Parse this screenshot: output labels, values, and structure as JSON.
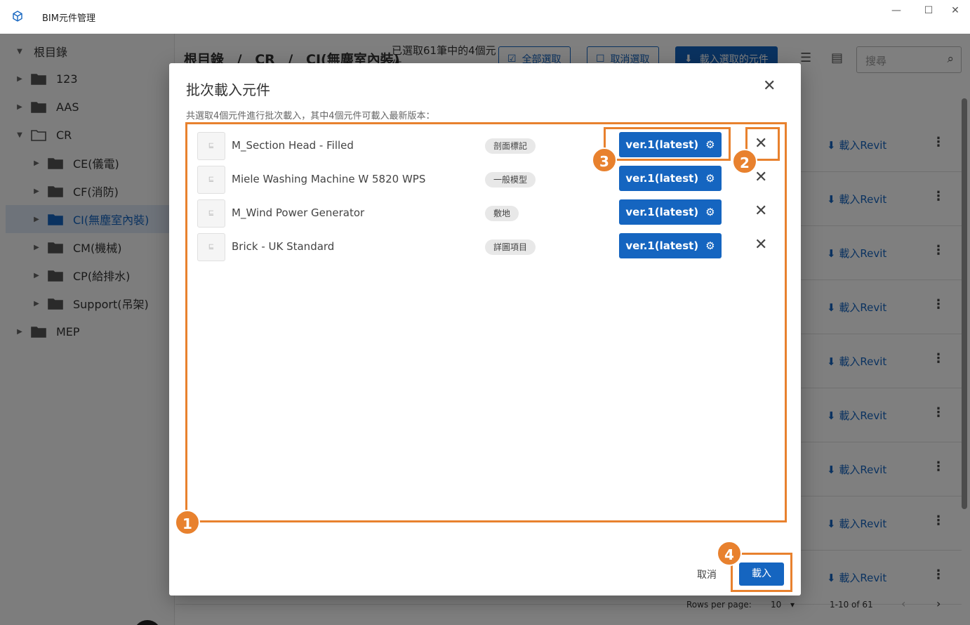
{
  "window": {
    "title": "BIM元件管理",
    "controls": [
      "—",
      "☐",
      "✕"
    ]
  },
  "sidebar": {
    "items": [
      {
        "label": "根目錄",
        "level": 0,
        "expanded": true,
        "has_folder": false
      },
      {
        "label": "123",
        "level": 1,
        "expanded": false,
        "has_folder": true
      },
      {
        "label": "AAS",
        "level": 1,
        "expanded": false,
        "has_folder": true
      },
      {
        "label": "CR",
        "level": 1,
        "expanded": true,
        "has_folder": true
      },
      {
        "label": "CE(儀電)",
        "level": 2,
        "expanded": false,
        "has_folder": true
      },
      {
        "label": "CF(消防)",
        "level": 2,
        "expanded": false,
        "has_folder": true
      },
      {
        "label": "CI(無塵室內裝)",
        "level": 2,
        "expanded": false,
        "has_folder": true,
        "selected": true
      },
      {
        "label": "CM(機械)",
        "level": 2,
        "expanded": false,
        "has_folder": true
      },
      {
        "label": "CP(給排水)",
        "level": 2,
        "expanded": false,
        "has_folder": true
      },
      {
        "label": "Support(吊架)",
        "level": 2,
        "expanded": false,
        "has_folder": true
      },
      {
        "label": "MEP",
        "level": 1,
        "expanded": false,
        "has_folder": true
      }
    ],
    "collapse_icon": "«"
  },
  "main": {
    "breadcrumb": [
      "根目錄",
      "/",
      "CR",
      "/",
      "CI(無塵室內裝)"
    ],
    "selection_info": "已選取61筆中的4個元件",
    "select_all_label": "全部選取",
    "deselect_label": "取消選取",
    "load_selected_label": "載入選取的元件",
    "search_placeholder": "搜尋",
    "row_action": "載入Revit",
    "row_count": 9,
    "pager": {
      "rows_per_page_label": "Rows per page:",
      "rows_per_page": "10",
      "range": "1-10 of 61"
    }
  },
  "dialog": {
    "title": "批次載入元件",
    "summary": "共選取4個元件進行批次載入，其中4個元件可載入最新版本：",
    "items": [
      {
        "name": "M_Section Head - Filled",
        "category": "剖面標記",
        "version": "ver.1(latest)"
      },
      {
        "name": "Miele Washing Machine W 5820 WPS",
        "category": "一般模型",
        "version": "ver.1(latest)"
      },
      {
        "name": "M_Wind Power Generator",
        "category": "敷地",
        "version": "ver.1(latest)"
      },
      {
        "name": "Brick - UK Standard",
        "category": "詳圖項目",
        "version": "ver.1(latest)"
      }
    ],
    "cancel_label": "取消",
    "load_label": "載入"
  },
  "annotations": [
    "1",
    "2",
    "3",
    "4"
  ],
  "colors": {
    "primary": "#1565c0",
    "annotation": "#e8812e"
  }
}
